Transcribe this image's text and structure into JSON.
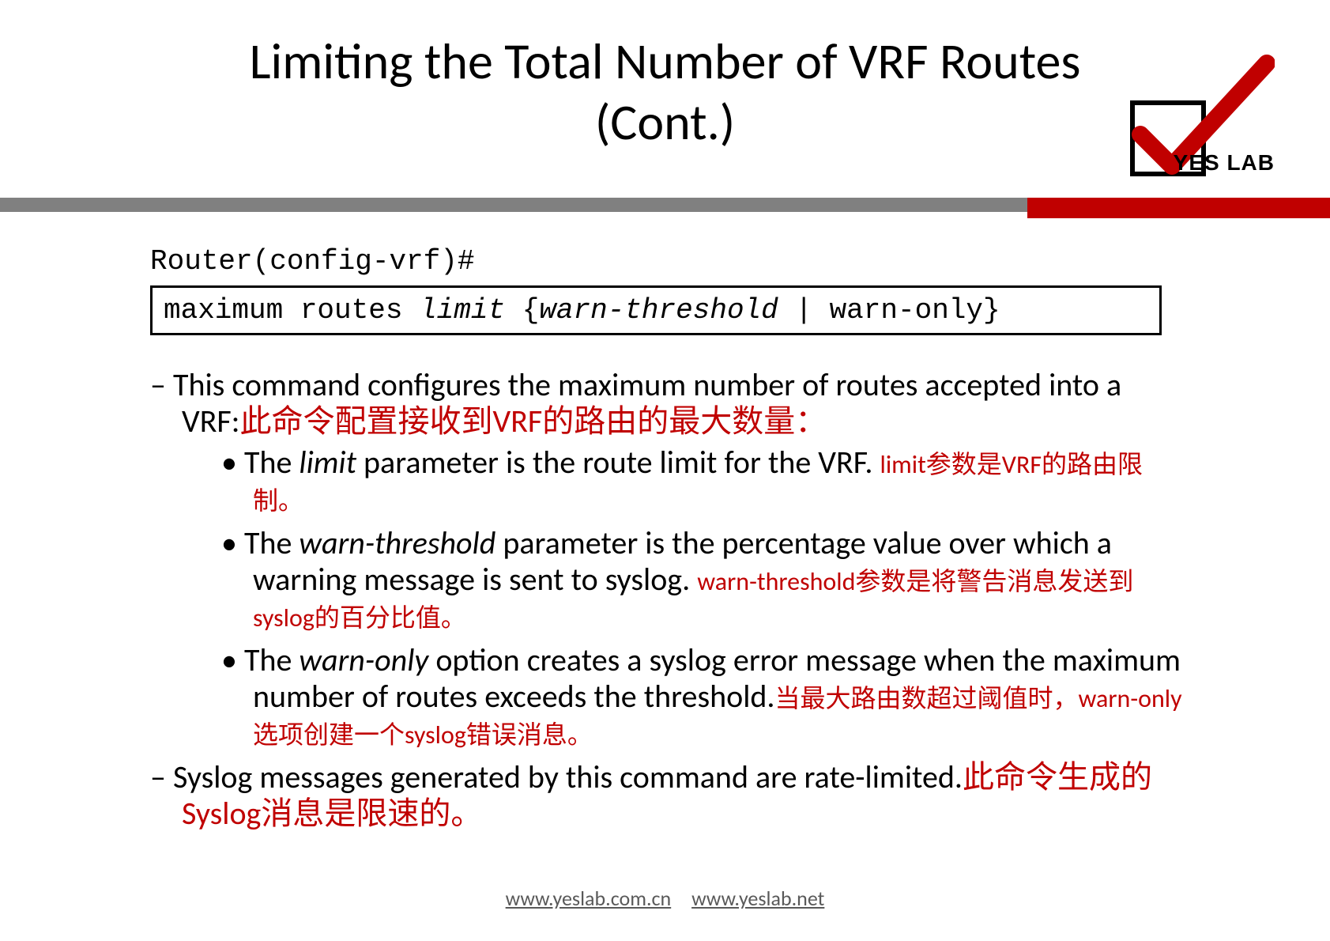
{
  "title": "Limiting the Total Number of VRF Routes (Cont.)",
  "logo_text": "YES LAB",
  "prompt": "Router(config-vrf)#",
  "cmd": {
    "prefix": "maximum routes ",
    "limit": "limit",
    "space1": " {",
    "warn_threshold": "warn-threshold",
    "suffix": "  | warn-only}"
  },
  "bullets": {
    "b1_en": "This command configures the maximum number of  routes accepted into a VRF:",
    "b1_cn": "此命令配置接收到VRF的路由的最大数量：",
    "b1a_en_pre": "The ",
    "b1a_en_it": "limit",
    "b1a_en_post": " parameter is the route limit for the VRF. ",
    "b1a_cn": "limit参数是VRF的路由限制。",
    "b1b_en_pre": "The ",
    "b1b_en_it": "warn-threshold",
    "b1b_en_post": " parameter is the percentage  value over which a warning message is sent to syslog. ",
    "b1b_cn": "warn-threshold参数是将警告消息发送到syslog的百分比值。",
    "b1c_en_pre": "The ",
    "b1c_en_it": "warn-only",
    "b1c_en_post": " option creates a syslog error message  when the maximum number of routes exceeds the  threshold.",
    "b1c_cn": "当最大路由数超过阈值时，warn-only选项创建一个syslog错误消息。",
    "b2_en": "Syslog messages generated by this command are  rate-limited.",
    "b2_cn": "此命令生成的Syslog消息是限速的。"
  },
  "footer": {
    "link1": "www.yeslab.com.cn",
    "link2": "www.yeslab.net"
  }
}
